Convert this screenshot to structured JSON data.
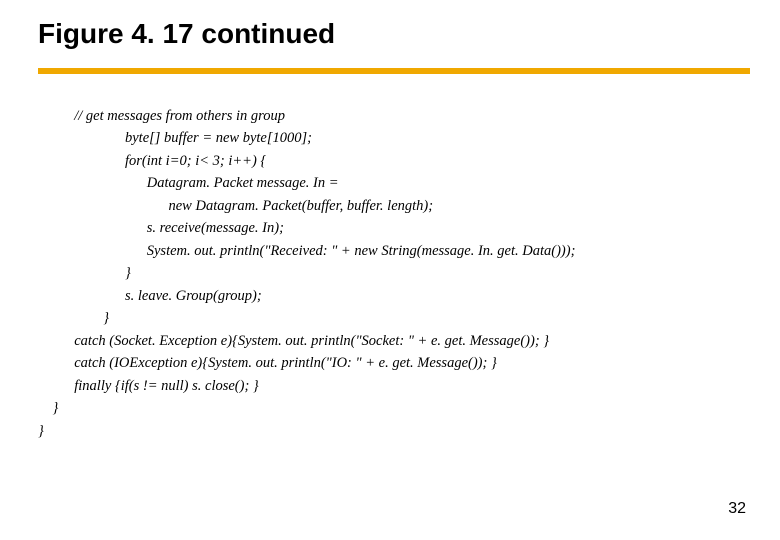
{
  "slide": {
    "title": "Figure 4. 17 continued",
    "page_number": "32"
  },
  "code": {
    "l0": "          // get messages from others in group",
    "l1": "                        byte[] buffer = new byte[1000];",
    "l2": "                        for(int i=0; i< 3; i++) {",
    "l3": "                              Datagram. Packet message. In =",
    "l4": "                                    new Datagram. Packet(buffer, buffer. length);",
    "l5": "                              s. receive(message. In);",
    "l6": "                              System. out. println(\"Received: \" + new String(message. In. get. Data()));",
    "l7": "                        }",
    "l8": "                        s. leave. Group(group);",
    "l9": "                  }",
    "l10": "          catch (Socket. Exception e){System. out. println(\"Socket: \" + e. get. Message()); }",
    "l11": "          catch (IOException e){System. out. println(\"IO: \" + e. get. Message()); }",
    "l12": "          finally {if(s != null) s. close(); }",
    "l13": "    }",
    "l14": "}"
  }
}
